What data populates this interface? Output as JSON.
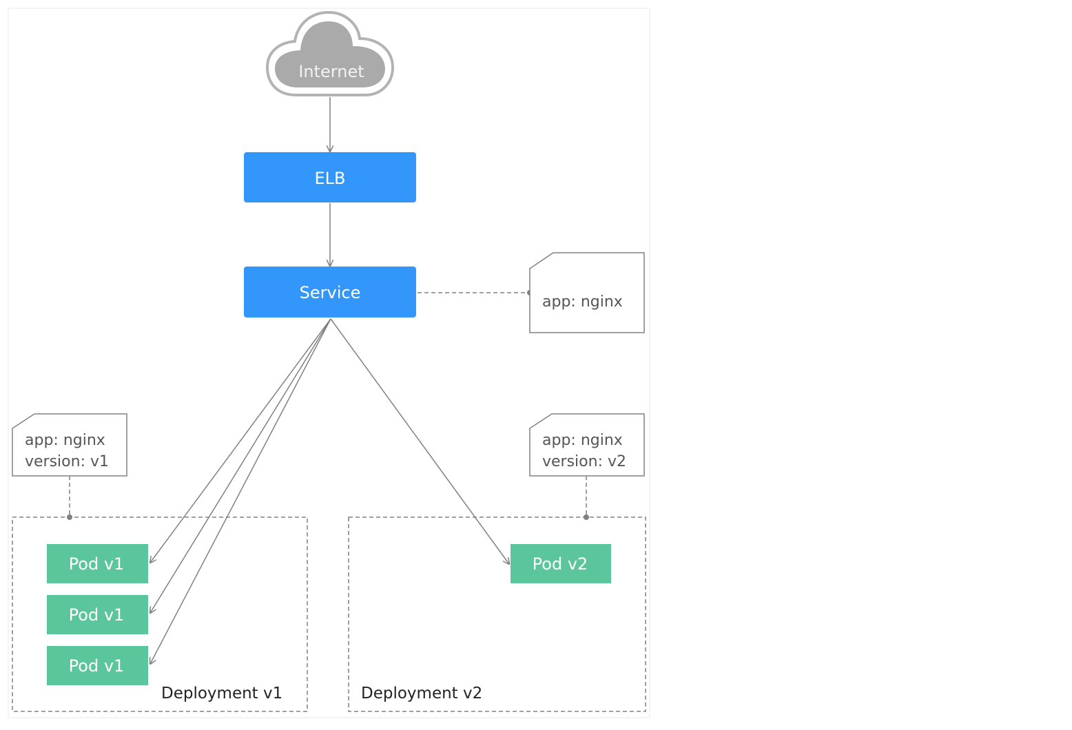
{
  "colors": {
    "blue": "#3396fb",
    "green": "#5bc59c",
    "line": "#808080",
    "cloud": "#aaaaaa",
    "text": "#555555"
  },
  "cloud": {
    "label": "Internet",
    "icon": "cloud-icon"
  },
  "elb": {
    "label": "ELB"
  },
  "service": {
    "label": "Service"
  },
  "service_tag": {
    "lines": [
      "app: nginx"
    ]
  },
  "tag_v1": {
    "lines": [
      "app: nginx",
      "version: v1"
    ]
  },
  "tag_v2": {
    "lines": [
      "app: nginx",
      "version: v2"
    ]
  },
  "deployment_v1": {
    "label": "Deployment v1",
    "pods": [
      "Pod v1",
      "Pod v1",
      "Pod v1"
    ]
  },
  "deployment_v2": {
    "label": "Deployment v2",
    "pods": [
      "Pod v2"
    ]
  }
}
